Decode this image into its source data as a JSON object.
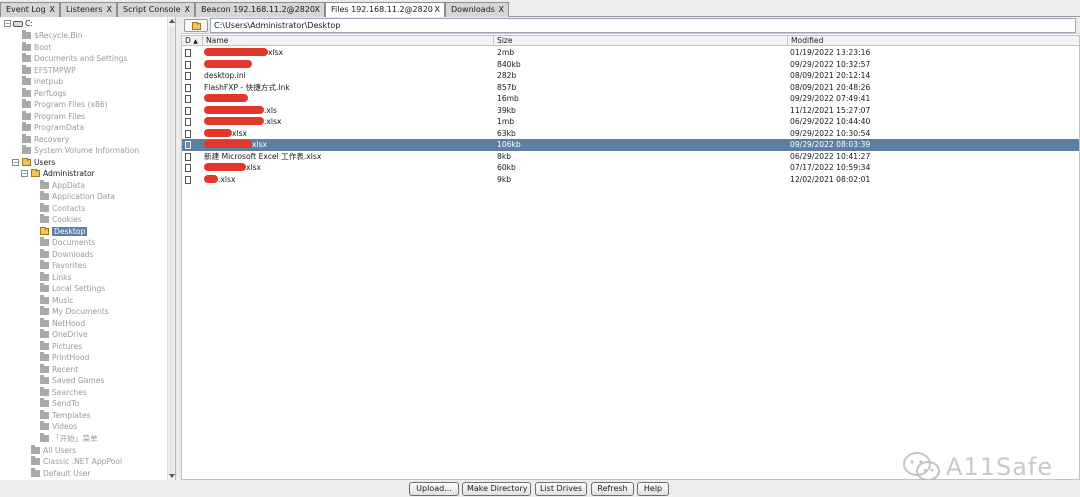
{
  "tabs": [
    {
      "label": "Event Log",
      "close": "X",
      "active": false
    },
    {
      "label": "Listeners",
      "close": "X",
      "active": false
    },
    {
      "label": "Script Console",
      "close": "X",
      "active": false
    },
    {
      "label": "Beacon 192.168.11.2@2820",
      "close": "X",
      "active": false
    },
    {
      "label": "Files 192.168.11.2@2820",
      "close": "X",
      "active": true
    },
    {
      "label": "Downloads",
      "close": "X",
      "active": false
    }
  ],
  "tree": {
    "root": "C:",
    "expand_minus": "−",
    "items": [
      {
        "label": "$Recycle.Bin"
      },
      {
        "label": "Boot"
      },
      {
        "label": "Documents and Settings"
      },
      {
        "label": "EFSTMPWP"
      },
      {
        "label": "inetpub"
      },
      {
        "label": "PerfLogs"
      },
      {
        "label": "Program Files (x86)"
      },
      {
        "label": "Program Files"
      },
      {
        "label": "ProgramData"
      },
      {
        "label": "Recovery"
      },
      {
        "label": "System Volume Information"
      }
    ],
    "users": "Users",
    "administrator": "Administrator",
    "admin_children": [
      {
        "label": "AppData"
      },
      {
        "label": "Application Data"
      },
      {
        "label": "Contacts"
      },
      {
        "label": "Cookies"
      },
      {
        "label": "Desktop"
      },
      {
        "label": "Documents"
      },
      {
        "label": "Downloads"
      },
      {
        "label": "Favorites"
      },
      {
        "label": "Links"
      },
      {
        "label": "Local Settings"
      },
      {
        "label": "Music"
      },
      {
        "label": "My Documents"
      },
      {
        "label": "NetHood"
      },
      {
        "label": "OneDrive"
      },
      {
        "label": "Pictures"
      },
      {
        "label": "PrintHood"
      },
      {
        "label": "Recent"
      },
      {
        "label": "Saved Games"
      },
      {
        "label": "Searches"
      },
      {
        "label": "SendTo"
      },
      {
        "label": "Templates"
      },
      {
        "label": "Videos"
      },
      {
        "label": "「开始」菜单"
      }
    ],
    "users_tail": [
      {
        "label": "All Users"
      },
      {
        "label": "Classic .NET AppPool"
      },
      {
        "label": "Default User"
      }
    ]
  },
  "path": {
    "value": "C:\\Users\\Administrator\\Desktop"
  },
  "table": {
    "headers": {
      "d": "D",
      "sort": "▲",
      "name": "Name",
      "size": "Size",
      "modified": "Modified"
    },
    "rows": [
      {
        "name": "xlsx",
        "size": "2mb",
        "modified": "01/19/2022 13:23:16"
      },
      {
        "name": "",
        "size": "840kb",
        "modified": "09/29/2022 10:32:57"
      },
      {
        "name": "desktop.ini",
        "size": "282b",
        "modified": "08/09/2021 20:12:14"
      },
      {
        "name": "FlashFXP - 快捷方式.lnk",
        "size": "857b",
        "modified": "08/09/2021 20:48:26"
      },
      {
        "name": "",
        "size": "16mb",
        "modified": "09/29/2022 07:49:41"
      },
      {
        "name": ".xls",
        "size": "39kb",
        "modified": "11/12/2021 15:27:07"
      },
      {
        "name": ".xlsx",
        "size": "1mb",
        "modified": "06/29/2022 10:44:40"
      },
      {
        "name": "xlsx",
        "size": "63kb",
        "modified": "09/29/2022 10:30:54"
      },
      {
        "name": "xlsx",
        "size": "106kb",
        "modified": "09/29/2022 08:03:39"
      },
      {
        "name": "新建 Microsoft Excel 工作表.xlsx",
        "size": "8kb",
        "modified": "06/29/2022 10:41:27"
      },
      {
        "name": "xlsx",
        "size": "60kb",
        "modified": "07/17/2022 10:59:34"
      },
      {
        "name": ".xlsx",
        "size": "9kb",
        "modified": "12/02/2021 08:02:01"
      }
    ]
  },
  "buttons": {
    "upload": "Upload...",
    "make_directory": "Make Directory",
    "list_drives": "List Drives",
    "refresh": "Refresh",
    "help": "Help"
  },
  "watermark": {
    "text": "A11Safe"
  },
  "colors": {
    "selection": "#5e7fa2",
    "redaction": "#e3372b",
    "folder_open": "#f0c75a"
  }
}
